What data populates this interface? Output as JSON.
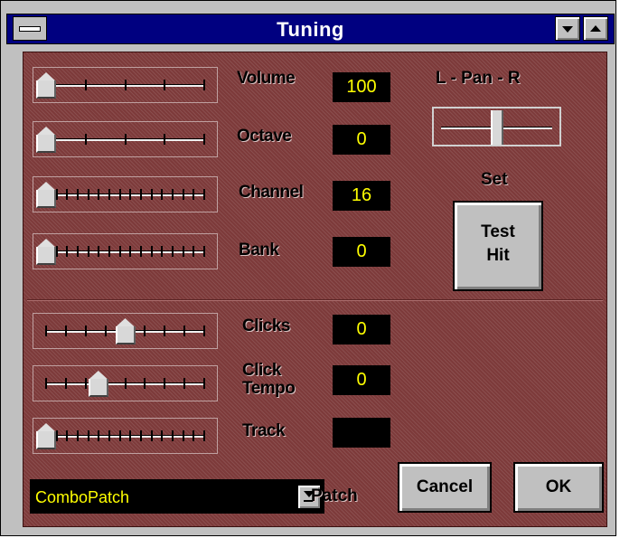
{
  "window": {
    "title": "Tuning"
  },
  "sliders": [
    {
      "label": "Volume",
      "value": "100",
      "position": 0.0,
      "ticks": 5
    },
    {
      "label": "Octave",
      "value": "0",
      "position": 0.0,
      "ticks": 5
    },
    {
      "label": "Channel",
      "value": "16",
      "position": 0.0,
      "ticks": 16
    },
    {
      "label": "Bank",
      "value": "0",
      "position": 0.0,
      "ticks": 16
    },
    {
      "label": "Clicks",
      "value": "0",
      "position": 0.5,
      "ticks": 9
    },
    {
      "label": "Click\nTempo",
      "value": "0",
      "position": 0.33,
      "ticks": 9
    },
    {
      "label": "Track",
      "value": "",
      "position": 0.0,
      "ticks": 16
    }
  ],
  "pan": {
    "label": "L - Pan - R",
    "position": 0.5
  },
  "set_label": "Set",
  "test_hit_button": "Test\nHit",
  "patch": {
    "value": "ComboPatch",
    "label": "Patch"
  },
  "buttons": {
    "cancel": "Cancel",
    "ok": "OK"
  },
  "colors": {
    "panel": "#7d3a3a",
    "value_text": "#ffff00",
    "titlebar": "#000080"
  }
}
